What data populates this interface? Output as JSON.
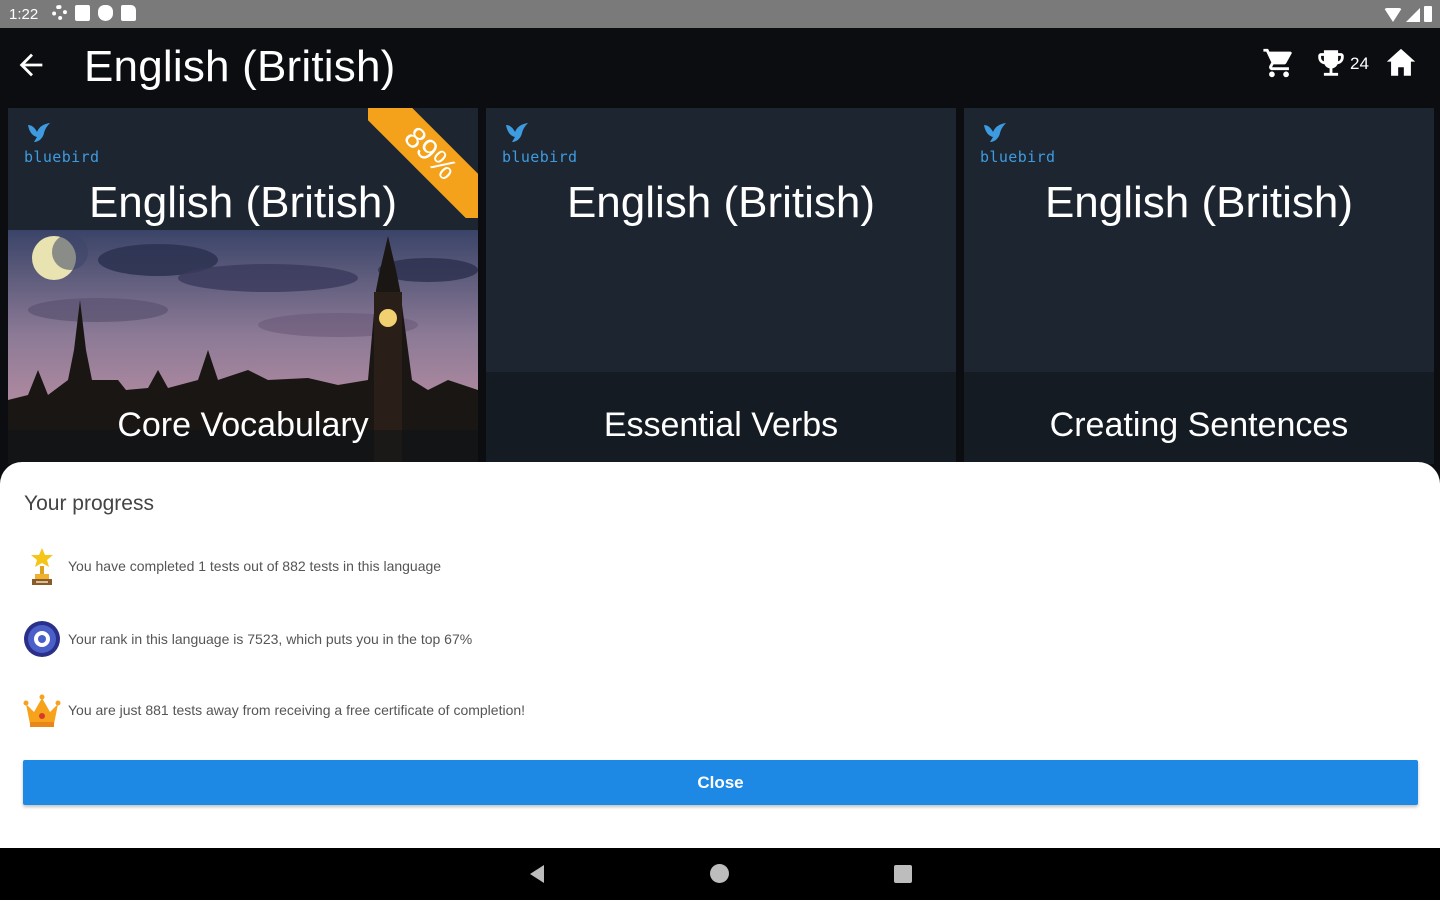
{
  "status_bar": {
    "time": "1:22"
  },
  "app_bar": {
    "title": "English (British)",
    "trophy_count": "24"
  },
  "cards": [
    {
      "brand": "bluebird",
      "language": "English (British)",
      "course": "Core Vocabulary",
      "progress_badge": "89%"
    },
    {
      "brand": "bluebird",
      "language": "English (British)",
      "course": "Essential Verbs"
    },
    {
      "brand": "bluebird",
      "language": "English (British)",
      "course": "Creating Sentences"
    }
  ],
  "progress_sheet": {
    "title": "Your progress",
    "rows": [
      {
        "icon": "trophy-icon",
        "text": "You have completed 1 tests out of 882 tests in this language"
      },
      {
        "icon": "rank-medal-icon",
        "text": "Your rank in this language is 7523, which puts you in the top 67%"
      },
      {
        "icon": "crown-icon",
        "text": "You are just 881 tests away from receiving a free certificate of completion!"
      }
    ],
    "close_label": "Close"
  },
  "colors": {
    "accent": "#1e88e5",
    "badge": "#f4a21b",
    "brand": "#3e9be0",
    "card_bg": "#1c2530"
  }
}
